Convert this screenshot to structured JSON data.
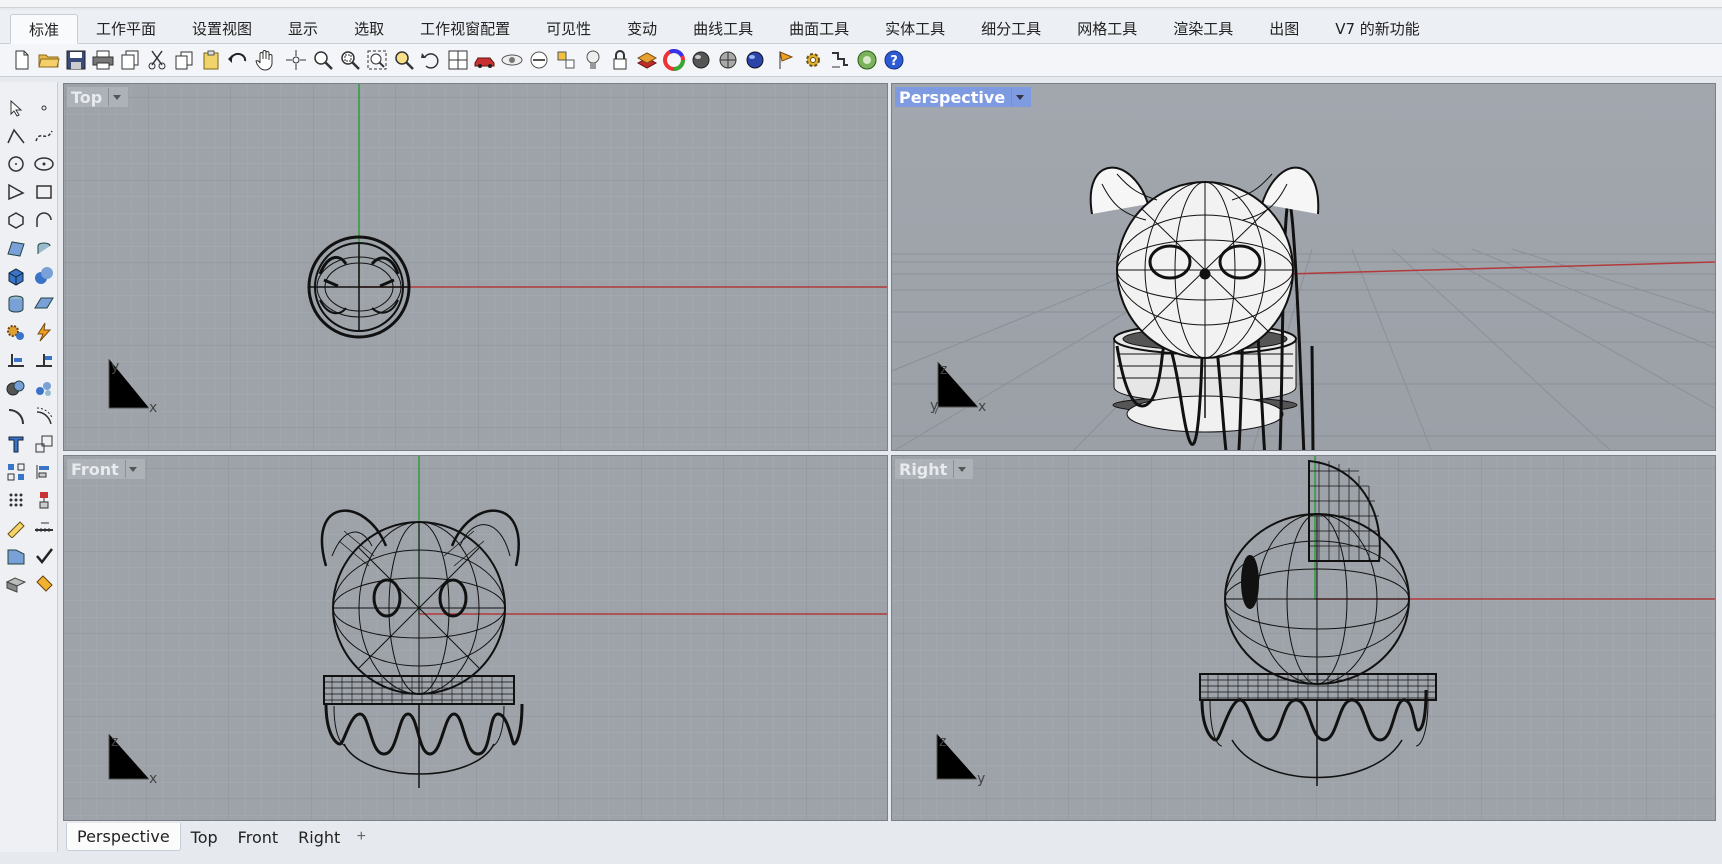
{
  "ribbon": {
    "tabs": [
      {
        "label": "标准",
        "active": true
      },
      {
        "label": "工作平面"
      },
      {
        "label": "设置视图"
      },
      {
        "label": "显示"
      },
      {
        "label": "选取"
      },
      {
        "label": "工作视窗配置"
      },
      {
        "label": "可见性"
      },
      {
        "label": "变动"
      },
      {
        "label": "曲线工具"
      },
      {
        "label": "曲面工具"
      },
      {
        "label": "实体工具"
      },
      {
        "label": "细分工具"
      },
      {
        "label": "网格工具"
      },
      {
        "label": "渲染工具"
      },
      {
        "label": "出图"
      },
      {
        "label": "V7 的新功能"
      }
    ]
  },
  "toolbar": {
    "icons": [
      "new-file-icon",
      "open-folder-icon",
      "save-icon",
      "print-icon",
      "copy-document-icon",
      "cut-icon",
      "copy-icon",
      "paste-icon",
      "undo-icon",
      "pan-hand-icon",
      "rotate-view-icon",
      "zoom-icon",
      "zoom-window-icon",
      "zoom-extents-icon",
      "zoom-selected-icon",
      "undo-view-icon",
      "four-viewports-icon",
      "car-object-icon",
      "hide-objects-icon",
      "show-objects-icon",
      "snap-icon",
      "lightbulb-icon",
      "lock-icon",
      "layer-icon",
      "color-wheel-icon",
      "shaded-sphere-icon",
      "rendered-sphere-icon",
      "blue-sphere-icon",
      "flag-icon",
      "gear-icon",
      "dimension-icon",
      "globe-icon",
      "help-icon"
    ]
  },
  "left_toolbar": {
    "icons": [
      "select-arrow-icon",
      "point-icon",
      "polyline-icon",
      "curve-icon",
      "circle-icon",
      "ellipse-icon",
      "triangle-icon",
      "rectangle-icon",
      "polygon-icon",
      "arc-icon",
      "surface-icon",
      "revolve-icon",
      "box-icon",
      "sphere-group-icon",
      "cylinder-icon",
      "plane-icon",
      "gear-solid-icon",
      "lightning-icon",
      "extrude-icon",
      "blend-icon",
      "boolean-icon",
      "split-icon",
      "fillet-icon",
      "offset-icon",
      "text-icon",
      "scale-icon",
      "array-icon",
      "align-icon",
      "block-icon",
      "measure-icon",
      "grid-snap-icon",
      "ruler-icon",
      "layout-icon",
      "check-icon",
      "shade-icon",
      "paint-icon"
    ]
  },
  "viewports": {
    "top": {
      "title": "Top",
      "axis1": "y",
      "axis2": "x"
    },
    "perspective": {
      "title": "Perspective",
      "axis1": "z",
      "axis2": "y",
      "axis3": "x"
    },
    "front": {
      "title": "Front",
      "axis1": "z",
      "axis2": "x"
    },
    "right": {
      "title": "Right",
      "axis1": "z",
      "axis2": "y"
    }
  },
  "bottom_tabs": {
    "tabs": [
      {
        "label": "Perspective",
        "active": true
      },
      {
        "label": "Top"
      },
      {
        "label": "Front"
      },
      {
        "label": "Right"
      }
    ],
    "add_label": "+"
  },
  "colors": {
    "viewport_bg": "#9ea3aa",
    "grid_minor": "#a6abb2",
    "grid_major": "#8c9198",
    "x_axis": "#b23a3a",
    "y_axis": "#2e9c3a",
    "active_title": "#7e9ae0"
  }
}
